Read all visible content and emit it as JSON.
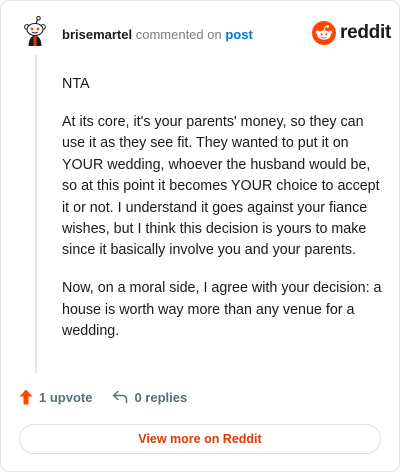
{
  "header": {
    "author": "brisemartel",
    "commented_text": "commented on",
    "post_link": "post",
    "brand": "reddit"
  },
  "comment": {
    "paragraphs": [
      "NTA",
      "At its core, it's your parents' money, so they can use it as they see fit. They wanted to put it on YOUR wedding, whoever the husband would be, so at this point it becomes YOUR choice to accept it or not. I understand it goes against your fiance wishes, but I think this decision is yours to make since it basically involve you and your parents.",
      "Now, on a moral side, I agree with your decision: a house is worth way more than any venue for a wedding."
    ]
  },
  "actions": {
    "upvote_label": "1 upvote",
    "replies_label": "0 replies"
  },
  "footer": {
    "view_more_label": "View more on Reddit"
  },
  "colors": {
    "reddit_orange": "#ff4500",
    "link_blue": "#0079d3",
    "button_text": "#d93a00"
  },
  "icons": {
    "avatar": "snoo-avatar",
    "logo": "reddit-logo-icon",
    "upvote": "upvote-arrow-icon",
    "reply": "reply-arrow-icon"
  }
}
